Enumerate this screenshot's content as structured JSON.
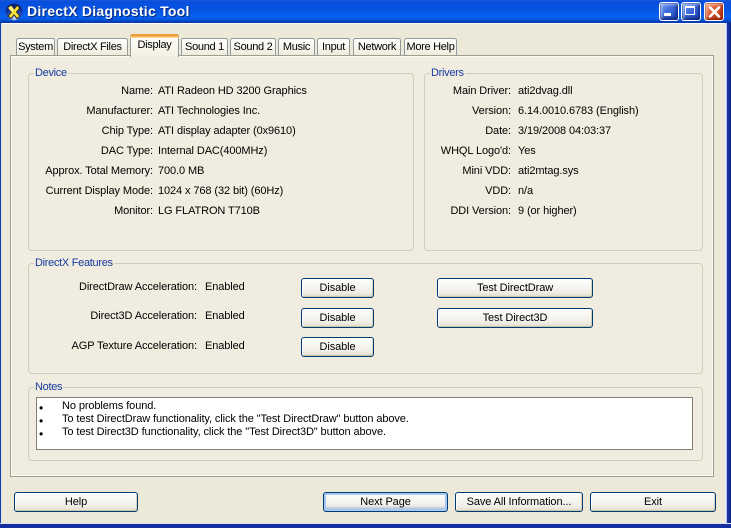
{
  "window": {
    "title": "DirectX Diagnostic Tool",
    "controls": {
      "minimize": "minimize",
      "maximize": "maximize",
      "close": "close"
    }
  },
  "tabs": [
    {
      "label": "System",
      "active": false
    },
    {
      "label": "DirectX Files",
      "active": false
    },
    {
      "label": "Display",
      "active": true
    },
    {
      "label": "Sound 1",
      "active": false
    },
    {
      "label": "Sound 2",
      "active": false
    },
    {
      "label": "Music",
      "active": false
    },
    {
      "label": "Input",
      "active": false
    },
    {
      "label": "Network",
      "active": false
    },
    {
      "label": "More Help",
      "active": false
    }
  ],
  "device": {
    "title": "Device",
    "rows": [
      {
        "label": "Name:",
        "value": "ATI Radeon HD 3200 Graphics"
      },
      {
        "label": "Manufacturer:",
        "value": "ATI Technologies Inc."
      },
      {
        "label": "Chip Type:",
        "value": "ATI display adapter (0x9610)"
      },
      {
        "label": "DAC Type:",
        "value": "Internal DAC(400MHz)"
      },
      {
        "label": "Approx. Total Memory:",
        "value": "700.0 MB"
      },
      {
        "label": "Current Display Mode:",
        "value": "1024 x 768 (32 bit) (60Hz)"
      },
      {
        "label": "Monitor:",
        "value": "LG FLATRON T710B"
      }
    ]
  },
  "drivers": {
    "title": "Drivers",
    "rows": [
      {
        "label": "Main Driver:",
        "value": "ati2dvag.dll"
      },
      {
        "label": "Version:",
        "value": "6.14.0010.6783 (English)"
      },
      {
        "label": "Date:",
        "value": "3/19/2008 04:03:37"
      },
      {
        "label": "WHQL Logo'd:",
        "value": "Yes"
      },
      {
        "label": "Mini VDD:",
        "value": "ati2mtag.sys"
      },
      {
        "label": "VDD:",
        "value": "n/a"
      },
      {
        "label": "DDI Version:",
        "value": "9 (or higher)"
      }
    ]
  },
  "features": {
    "title": "DirectX Features",
    "rows": [
      {
        "label": "DirectDraw Acceleration:",
        "value": "Enabled",
        "disable_button": "Disable",
        "test_button": "Test DirectDraw"
      },
      {
        "label": "Direct3D Acceleration:",
        "value": "Enabled",
        "disable_button": "Disable",
        "test_button": "Test Direct3D"
      },
      {
        "label": "AGP Texture Acceleration:",
        "value": "Enabled",
        "disable_button": "Disable"
      }
    ]
  },
  "notes": {
    "title": "Notes",
    "bullet": "•",
    "items": [
      "No problems found.",
      "To test DirectDraw functionality, click the \"Test DirectDraw\" button above.",
      "To test Direct3D functionality, click the \"Test Direct3D\" button above."
    ]
  },
  "footer": {
    "help": "Help",
    "next_page": "Next Page",
    "save_all": "Save All Information...",
    "exit": "Exit"
  },
  "colors": {
    "titlebar_blue": "#0553e0",
    "dialog_face": "#ece9d8",
    "group_title_blue": "#16399f",
    "active_tab_stripe": "#e68b2c",
    "button_border": "#003c74",
    "close_button_red": "#d1502a"
  }
}
